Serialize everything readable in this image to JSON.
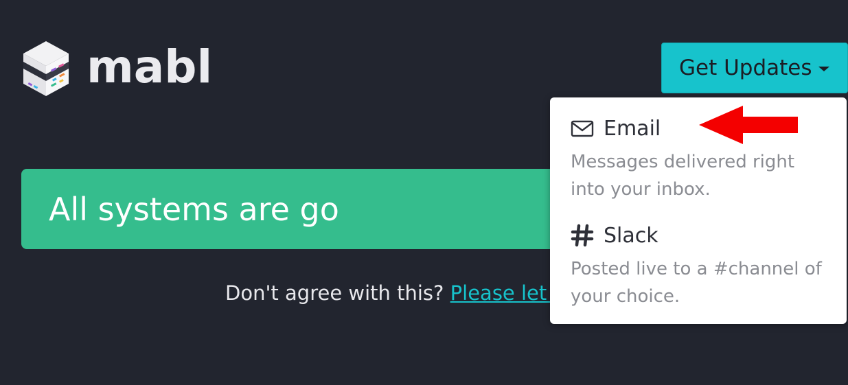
{
  "brand": {
    "name": "mabl"
  },
  "header": {
    "updates_button": {
      "label": "Get Updates",
      "caret_icon": "caret-down-icon"
    }
  },
  "status": {
    "message": "All systems are go",
    "color": "#35bd8d"
  },
  "feedback": {
    "prefix": "Don't agree with this? ",
    "link_text": "Please let u"
  },
  "dropdown": {
    "items": [
      {
        "title": "Email",
        "icon": "envelope-icon",
        "description": "Messages delivered right into your inbox."
      },
      {
        "title": "Slack",
        "icon": "hash-icon",
        "description": "Posted live to a #channel of your choice."
      }
    ]
  },
  "colors": {
    "accent": "#17c3cc",
    "background": "#22252f",
    "annotation_arrow": "#f40000"
  }
}
